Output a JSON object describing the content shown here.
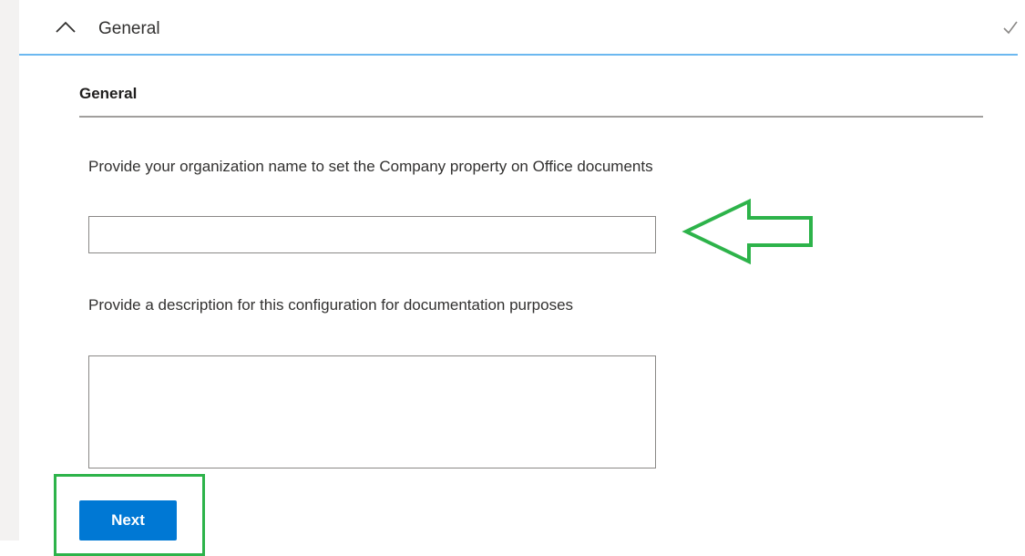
{
  "section": {
    "title": "General",
    "expanded": true,
    "completed": true,
    "accent_color": "#0078d4"
  },
  "subsection": {
    "title": "General"
  },
  "fields": {
    "organization_name": {
      "label": "Provide your organization name to set the Company property on Office documents",
      "value": "",
      "placeholder": ""
    },
    "description": {
      "label": "Provide a description for this configuration for documentation purposes",
      "value": "",
      "placeholder": ""
    }
  },
  "actions": {
    "next_label": "Next",
    "button_color": "#0078d4"
  },
  "annotations": {
    "arrow_color": "#2db34a",
    "arrow_target": "organization-name-input",
    "highlight_color": "#2db34a",
    "highlight_target": "next-button"
  },
  "icons": {
    "collapse": "chevron-up-icon",
    "status": "checkmark-icon"
  }
}
